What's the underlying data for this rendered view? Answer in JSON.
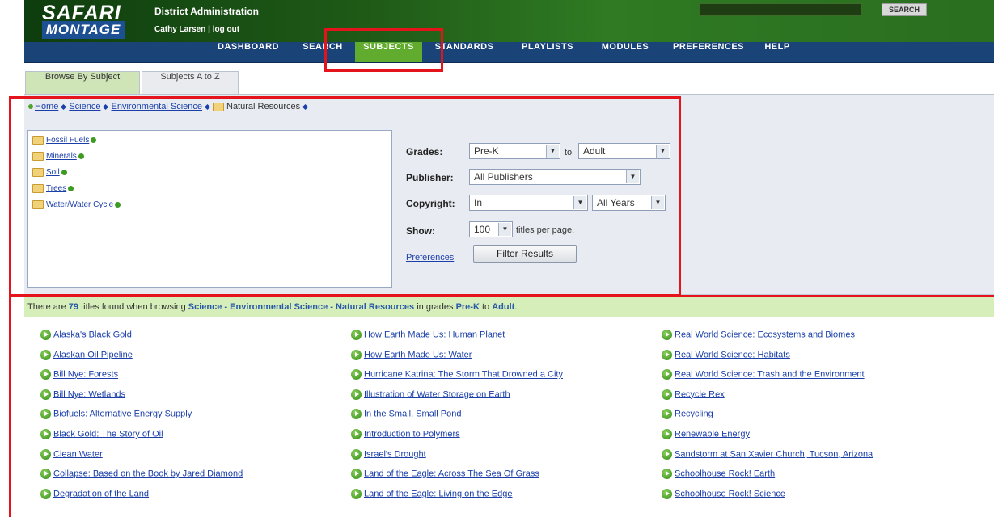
{
  "header": {
    "logo_top": "SAFARI",
    "logo_bottom": "MONTAGE",
    "district": "District Administration",
    "user": "Cathy Larsen",
    "separator": "|",
    "logout": "log out",
    "search_label": "SEARCH"
  },
  "nav": [
    "DASHBOARD",
    "SEARCH",
    "SUBJECTS",
    "STANDARDS",
    "PLAYLISTS",
    "MODULES",
    "PREFERENCES",
    "HELP"
  ],
  "tabs": [
    "Browse By Subject",
    "Subjects A to Z"
  ],
  "breadcrumb": [
    "Home",
    "Science",
    "Environmental Science",
    "Natural Resources"
  ],
  "subfolders": [
    "Fossil Fuels",
    "Minerals",
    "Soil",
    "Trees",
    "Water/Water Cycle"
  ],
  "filters": {
    "grades_label": "Grades:",
    "grade_from": "Pre-K",
    "to": "to",
    "grade_to": "Adult",
    "publisher_label": "Publisher:",
    "publisher": "All Publishers",
    "copyright_label": "Copyright:",
    "copyright_mode": "In",
    "copyright_years": "All Years",
    "show_label": "Show:",
    "show_value": "100",
    "per_page": "titles per page.",
    "preferences": "Preferences",
    "filter_button": "Filter Results"
  },
  "results": {
    "prefix": "There are",
    "count": "79",
    "mid": "titles found when browsing",
    "path": "Science - Environmental Science - Natural Resources",
    "grades_text": "in grades",
    "from": "Pre-K",
    "to_text": "to",
    "to": "Adult",
    "column1": [
      "Alaska's Black Gold",
      "Alaskan Oil Pipeline",
      "Bill Nye: Forests",
      "Bill Nye: Wetlands",
      "Biofuels: Alternative Energy Supply",
      "Black Gold: The Story of Oil",
      "Clean Water",
      "Collapse: Based on the Book by Jared Diamond",
      "Degradation of the Land"
    ],
    "column2": [
      "How Earth Made Us: Human Planet",
      "How Earth Made Us: Water",
      "Hurricane Katrina: The Storm That Drowned a City",
      "Illustration of Water Storage on Earth",
      "In the Small, Small Pond",
      "Introduction to Polymers",
      "Israel's Drought",
      "Land of the Eagle: Across The Sea Of Grass",
      "Land of the Eagle: Living on the Edge"
    ],
    "column3": [
      "Real World Science: Ecosystems and Biomes",
      "Real World Science: Habitats",
      "Real World Science: Trash and the Environment",
      "Recycle Rex",
      "Recycling",
      "Renewable Energy",
      "Sandstorm at San Xavier Church, Tucson, Arizona",
      "Schoolhouse Rock! Earth",
      "Schoolhouse Rock! Science"
    ]
  },
  "colors": {
    "nav_bg": "#1a4378",
    "nav_active": "#61ac2e",
    "header_green": "#1f5a17",
    "link": "#1a3fa8",
    "highlight": "#e5141c"
  }
}
